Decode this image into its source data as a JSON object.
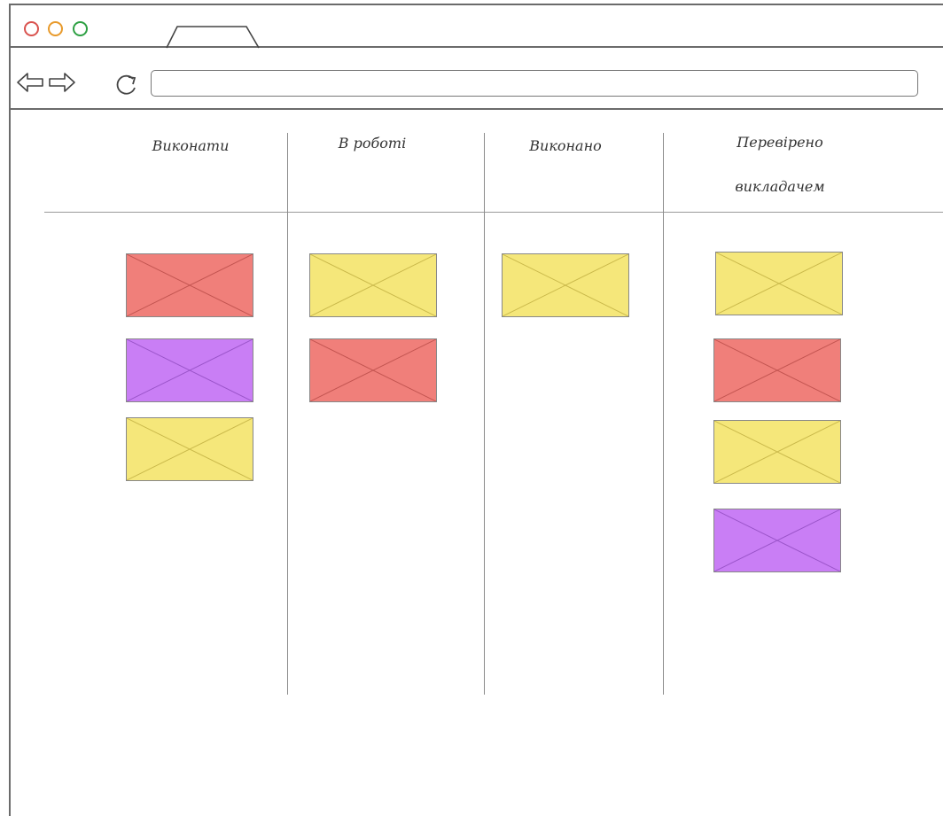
{
  "window": {
    "controls": [
      {
        "name": "close-dot",
        "color": "#d9534f"
      },
      {
        "name": "minimize-dot",
        "color": "#e89a2b"
      },
      {
        "name": "maximize-dot",
        "color": "#2ea043"
      }
    ],
    "nav": {
      "back_icon": "arrow-left-icon",
      "forward_icon": "arrow-right-icon",
      "reload_icon": "reload-icon"
    },
    "address_bar": {
      "value": "",
      "placeholder": ""
    }
  },
  "board": {
    "columns": [
      {
        "title": "Виконати",
        "cards": [
          "red",
          "purple",
          "yellow"
        ]
      },
      {
        "title": "В роботі",
        "cards": [
          "yellow",
          "red"
        ]
      },
      {
        "title": "Виконано",
        "cards": [
          "yellow"
        ]
      },
      {
        "title_line1": "Перевірено",
        "title_line2": "викладачем",
        "cards": [
          "yellow",
          "red",
          "yellow",
          "purple"
        ]
      }
    ],
    "card_colors": {
      "red": "#f07f7a",
      "purple": "#c97ef5",
      "yellow": "#f5e77a"
    }
  }
}
